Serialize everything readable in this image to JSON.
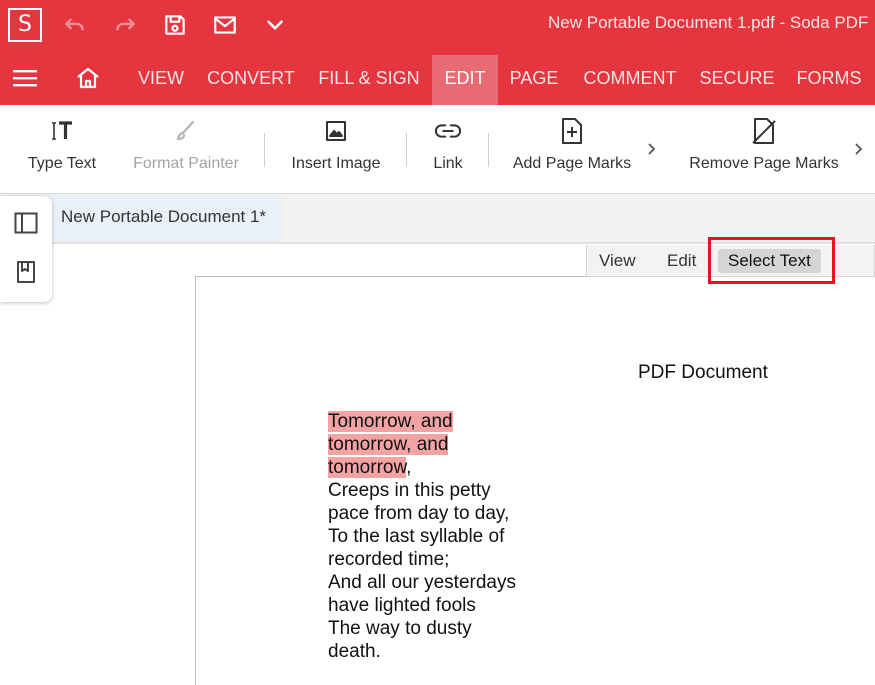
{
  "app": {
    "logo_letter": "S",
    "document_window_title": "New Portable Document 1.pdf   -   Soda PDF"
  },
  "quick_access": [
    "undo-icon",
    "redo-icon",
    "save-icon",
    "mail-icon",
    "chevron-down-icon"
  ],
  "ribbon": {
    "tabs": [
      {
        "label": "VIEW",
        "active": false
      },
      {
        "label": "CONVERT",
        "active": false
      },
      {
        "label": "FILL & SIGN",
        "active": false
      },
      {
        "label": "EDIT",
        "active": true
      },
      {
        "label": "PAGE",
        "active": false
      },
      {
        "label": "COMMENT",
        "active": false
      },
      {
        "label": "SECURE",
        "active": false
      },
      {
        "label": "FORMS",
        "active": false
      }
    ]
  },
  "toolbar": {
    "type_text": "Type Text",
    "format_painter": "Format Painter",
    "insert_image": "Insert Image",
    "link": "Link",
    "add_page_marks": "Add Page Marks",
    "remove_page_marks": "Remove Page Marks"
  },
  "document_tab": {
    "label": "New Portable Document 1*"
  },
  "mode_switch": {
    "view": "View",
    "edit": "Edit",
    "select_text": "Select Text",
    "selected": "Select Text"
  },
  "page": {
    "heading": "PDF Document",
    "poem_lines": [
      {
        "text": "Tomorrow, and",
        "selected": true
      },
      {
        "text": "tomorrow, and",
        "selected": true
      },
      {
        "text": "tomorrow",
        "selected": true,
        "suffix": ","
      },
      {
        "text": "Creeps in this petty",
        "selected": false
      },
      {
        "text": "pace from day to day,",
        "selected": false
      },
      {
        "text": "To the last syllable of",
        "selected": false
      },
      {
        "text": "recorded time;",
        "selected": false
      },
      {
        "text": "And all our yesterdays",
        "selected": false
      },
      {
        "text": "have lighted fools",
        "selected": false
      },
      {
        "text": "The way to dusty",
        "selected": false
      },
      {
        "text": "death.",
        "selected": false
      }
    ]
  },
  "colors": {
    "brand_red": "#e5353f",
    "active_tab": "#e86a72",
    "selection_highlight": "#f3a3a3",
    "annotation_box": "#e5141e"
  }
}
